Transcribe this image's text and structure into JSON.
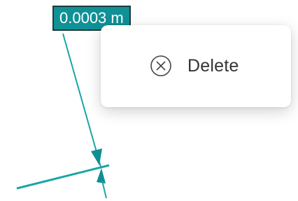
{
  "dimension": {
    "value_label": "0.0003 m"
  },
  "context_menu": {
    "items": [
      {
        "label": "Delete",
        "icon": "circle-x-icon"
      }
    ]
  },
  "colors": {
    "accent": "#0f9196",
    "label_border": "#1b3c3d",
    "menu_text": "#333333"
  }
}
